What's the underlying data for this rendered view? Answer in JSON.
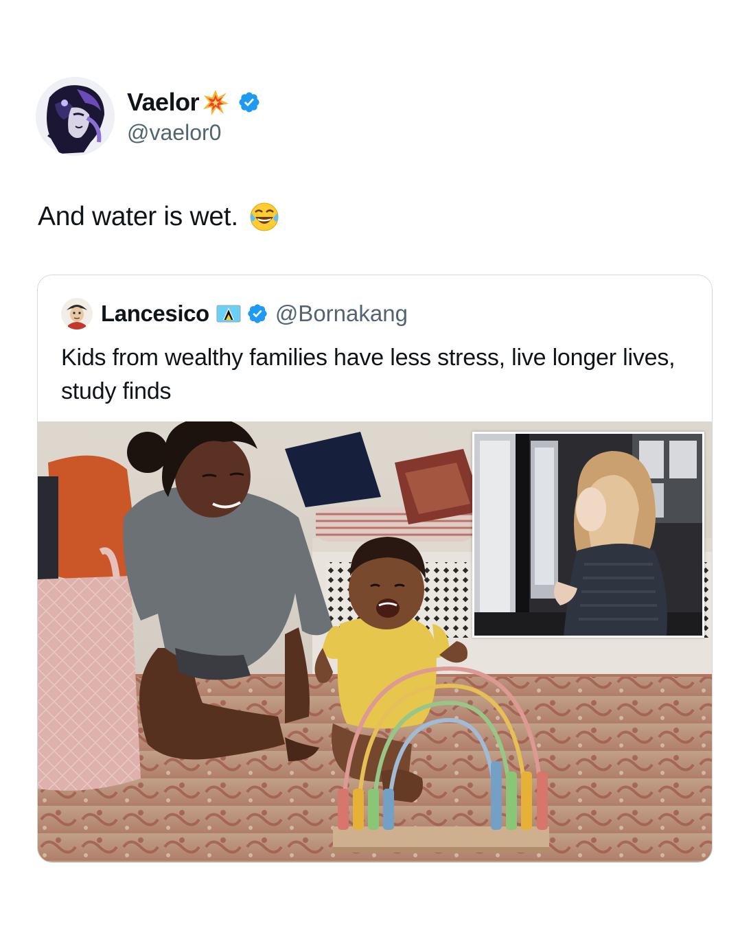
{
  "tweet": {
    "author": {
      "display_name": "Vaelor",
      "name_emoji": "collision-emoji",
      "handle": "@vaelor0",
      "verified": true
    },
    "text": "And water is wet.",
    "text_emoji": "face-with-tears-of-joy-emoji"
  },
  "quoted_tweet": {
    "author": {
      "display_name": "Lancesico",
      "flag": "saint-lucia-flag",
      "handle": "@Bornakang",
      "verified": true
    },
    "text": "Kids from wealthy families have less stress, live longer lives, study finds",
    "media": {
      "main_image": "mother-and-smiling-baby-playing-with-rainbow-abacus-on-patterned-rug",
      "inset_image": "young-girl-looking-out-of-window"
    }
  },
  "colors": {
    "verified_blue": "#1d9bf0",
    "handle_gray": "#536471",
    "card_border": "#cfd9de"
  }
}
